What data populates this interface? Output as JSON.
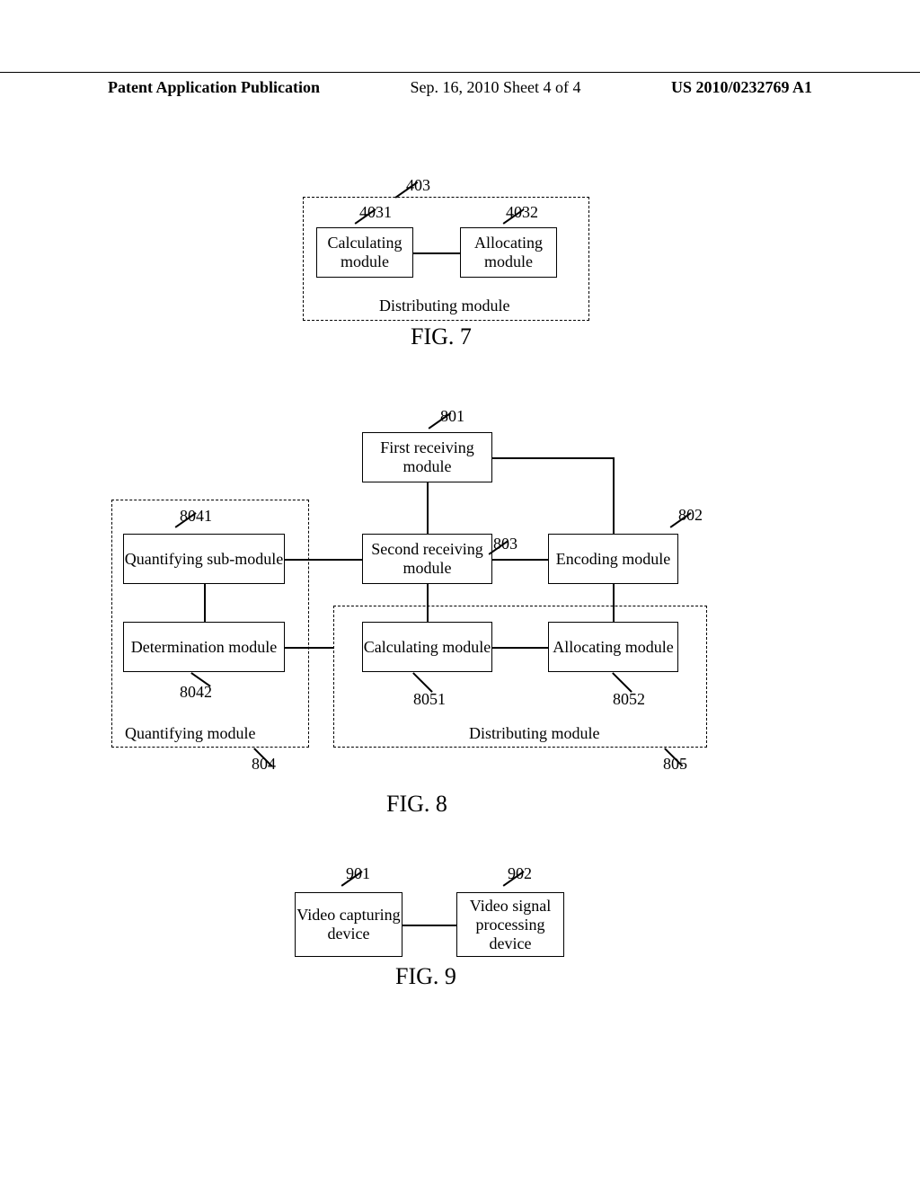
{
  "header": {
    "left": "Patent Application Publication",
    "middle": "Sep. 16, 2010  Sheet 4 of 4",
    "right": "US 2010/0232769 A1"
  },
  "fig7": {
    "ref_main": "403",
    "ref_left": "4031",
    "ref_right": "4032",
    "calculating": "Calculating module",
    "allocating": "Allocating module",
    "distributing": "Distributing module",
    "caption": "FIG. 7"
  },
  "fig8": {
    "ref_top": "801",
    "first_recv": "First receiving module",
    "ref_left_group": "8041",
    "quant_sub": "Quantifying sub-module",
    "second_recv": "Second receiving module",
    "ref_mid": "803",
    "encoding": "Encoding module",
    "ref_enc": "802",
    "determ": "Determination module",
    "ref_determ": "8042",
    "calc": "Calculating module",
    "ref_calc": "8051",
    "alloc": "Allocating module",
    "ref_alloc": "8052",
    "quant_mod": "Quantifying module",
    "ref_quant": "804",
    "dist_mod": "Distributing module",
    "ref_dist": "805",
    "caption": "FIG. 8"
  },
  "fig9": {
    "ref_left": "901",
    "ref_right": "902",
    "video_cap": "Video capturing device",
    "video_proc": "Video signal processing device",
    "caption": "FIG. 9"
  }
}
